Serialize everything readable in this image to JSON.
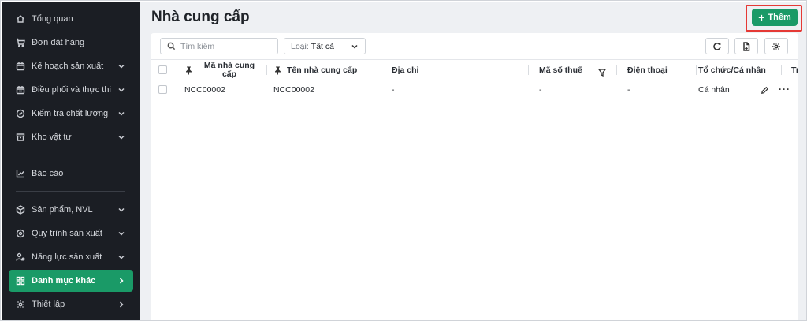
{
  "sidebar": {
    "items": [
      {
        "label": "Tổng quan",
        "icon": "home-icon",
        "has_chevron": false
      },
      {
        "label": "Đơn đặt hàng",
        "icon": "cart-icon",
        "has_chevron": false
      },
      {
        "label": "Kế hoạch sản xuất",
        "icon": "calendar-plan-icon",
        "has_chevron": true
      },
      {
        "label": "Điều phối và thực thi",
        "icon": "calendar-dispatch-icon",
        "has_chevron": true
      },
      {
        "label": "Kiểm tra chất lượng",
        "icon": "check-circle-icon",
        "has_chevron": true
      },
      {
        "label": "Kho vật tư",
        "icon": "archive-box-icon",
        "has_chevron": true
      },
      {
        "label": "Báo cáo",
        "icon": "chart-icon",
        "has_chevron": false
      },
      {
        "label": "Sản phẩm, NVL",
        "icon": "cube-icon",
        "has_chevron": true
      },
      {
        "label": "Quy trình sản xuất",
        "icon": "process-icon",
        "has_chevron": true
      },
      {
        "label": "Năng lực sản xuất",
        "icon": "user-gear-icon",
        "has_chevron": true
      },
      {
        "label": "Danh mục khác",
        "icon": "grid-icon",
        "has_chevron": true,
        "active": true
      },
      {
        "label": "Thiết lập",
        "icon": "gear-icon",
        "has_chevron": true
      }
    ]
  },
  "header": {
    "title": "Nhà cung cấp",
    "add_button": {
      "icon": "plus-icon",
      "label": "Thêm"
    },
    "highlight_color": "#e53935"
  },
  "toolbar": {
    "search_placeholder": "Tìm kiếm",
    "filter_label": "Loại:",
    "filter_value": "Tất cả",
    "buttons": [
      "refresh-icon",
      "export-file-icon",
      "settings-icon"
    ]
  },
  "table": {
    "columns": {
      "code": "Mã nhà cung cấp",
      "name": "Tên nhà cung cấp",
      "address": "Địa chỉ",
      "tax": "Mã số thuế",
      "phone": "Điện thoại",
      "org": "Tổ chức/Cá nhân",
      "extra": "Tr"
    },
    "rows": [
      {
        "code": "NCC00002",
        "name": "NCC00002",
        "address": "-",
        "tax": "-",
        "phone": "-",
        "org": "Cá nhân"
      }
    ]
  },
  "colors": {
    "sidebar_bg": "#1b1e24",
    "accent": "#1a9a67",
    "main_bg": "#eef0f3"
  }
}
